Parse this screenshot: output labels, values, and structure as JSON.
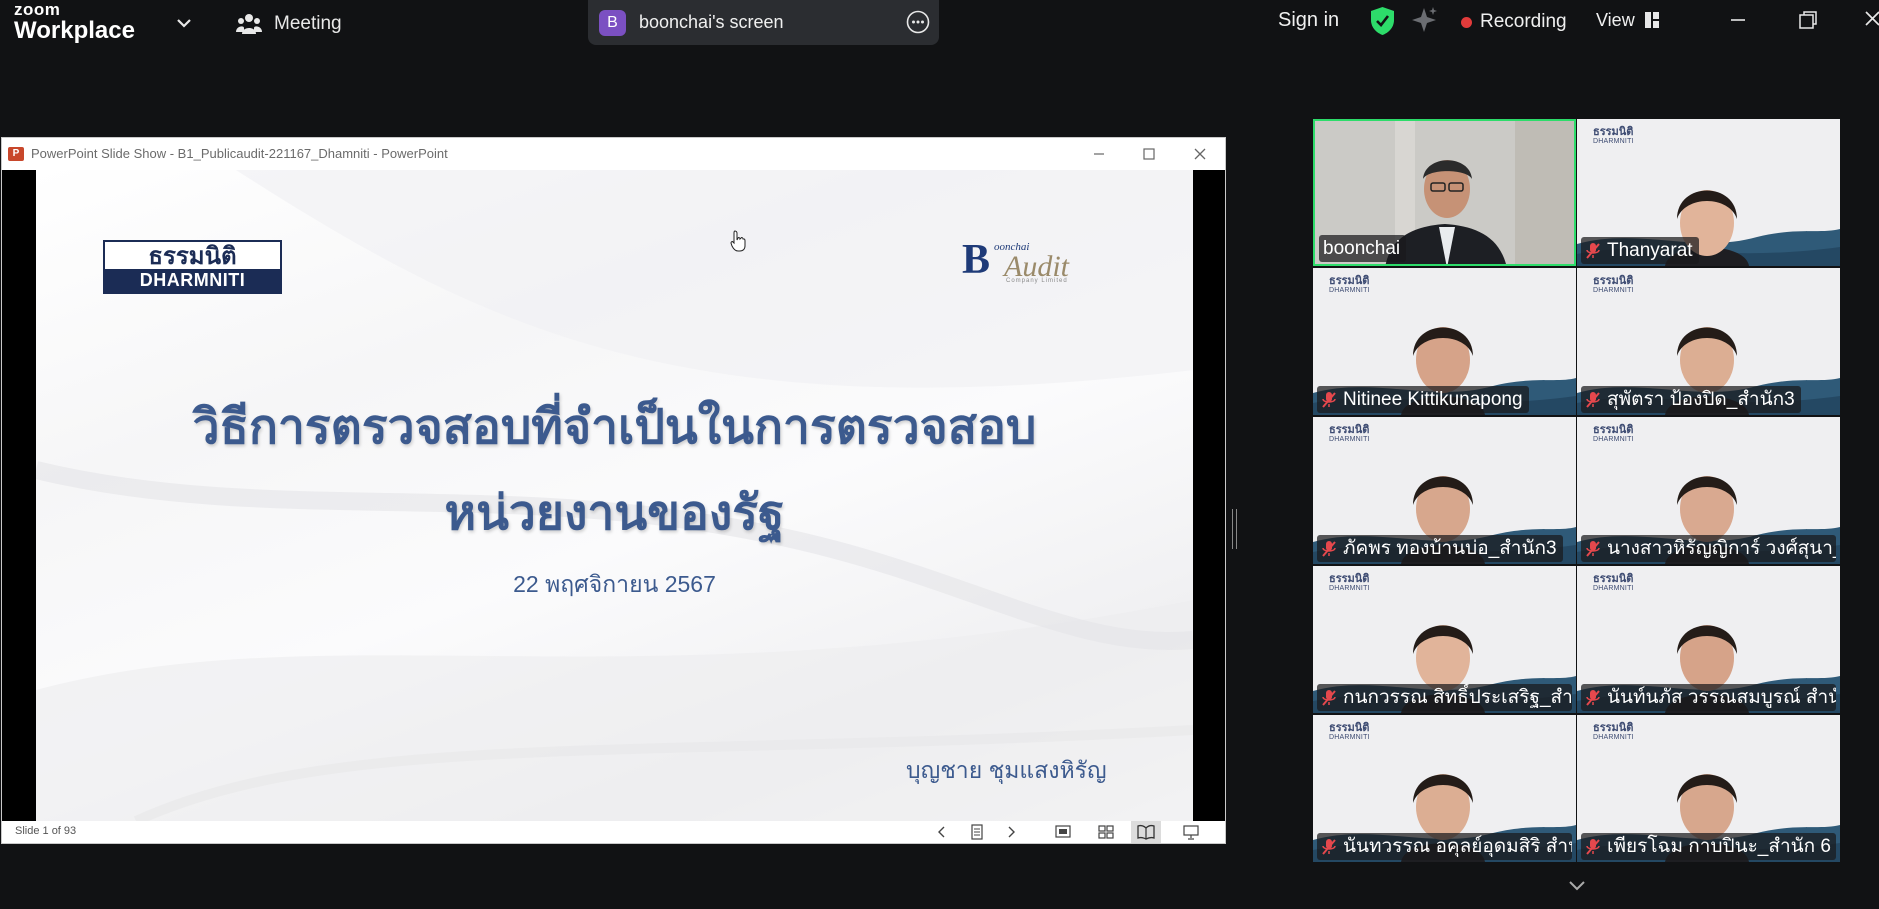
{
  "app": {
    "logo_top": "zoom",
    "logo_bottom": "Workplace",
    "meeting_label": "Meeting",
    "screen_badge": "B",
    "screen_title": "boonchai's screen",
    "sign_in": "Sign in",
    "recording": "Recording",
    "view": "View",
    "accent_green": "#2ddc6a",
    "recording_red": "#e23b3b"
  },
  "ppt": {
    "window_title": "PowerPoint Slide Show  -  B1_Publicaudit-221167_Dhamniti - PowerPoint",
    "slide_status": "Slide 1 of 93",
    "logo_left_th": "ธรรมนิติ",
    "logo_left_en": "DHARMNITI",
    "logo_right_b": "B",
    "logo_right_small": "oonchai",
    "logo_right_audit": "Audit",
    "logo_right_co": "Company Limited",
    "title_line1": "วิธีการตรวจสอบที่จำเป็นในการตรวจสอบ",
    "title_line2": "หน่วยงานของรัฐ",
    "date": "22 พฤศจิกายน 2567",
    "author": "บุญชาย ชุมแสงหิรัญ"
  },
  "gallery": {
    "mini_th": "ธรรมนิติ",
    "mini_en": "DHARMNITI",
    "participants": [
      {
        "name": "boonchai",
        "muted": false
      },
      {
        "name": "Thanyarat",
        "muted": true
      },
      {
        "name": "Nitinee Kittikunapong",
        "muted": true
      },
      {
        "name": "สุพัตรา   ป้องปิด_สำนัก3",
        "muted": true
      },
      {
        "name": "ภัคพร ทองบ้านบ่อ_สำนัก3",
        "muted": true
      },
      {
        "name": "นางสาวหิรัญญิการ์ วงศ์สุนา_...",
        "muted": true
      },
      {
        "name": "กนกวรรณ สิทธิ์ประเสริฐ_สำนั...",
        "muted": true
      },
      {
        "name": "นันท์นภัส วรรณสมบูรณ์ สำนัก...",
        "muted": true
      },
      {
        "name": "นันทวรรณ อคุลย์อุดมสิริ สำนั...",
        "muted": true
      },
      {
        "name": "เพียรโฉม กาบปินะ_สำนัก 6",
        "muted": true
      }
    ]
  }
}
